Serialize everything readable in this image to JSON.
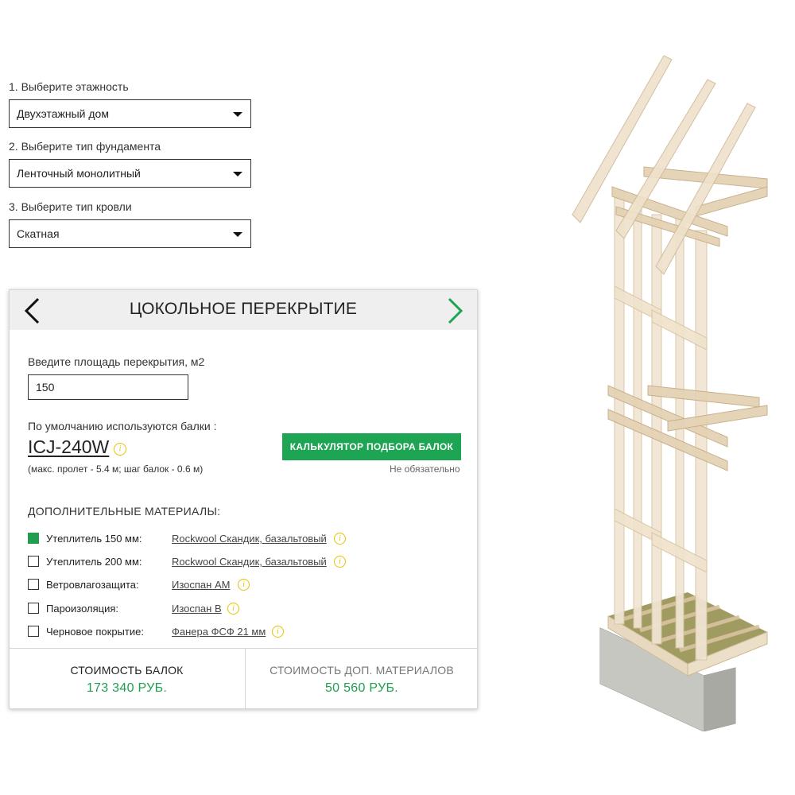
{
  "selectors": [
    {
      "label": "1. Выберите этажность",
      "value": "Двухэтажный дом"
    },
    {
      "label": "2. Выберите тип фундамента",
      "value": "Ленточный монолитный"
    },
    {
      "label": "3. Выберите тип кровли",
      "value": "Скатная"
    }
  ],
  "panel": {
    "title": "ЦОКОЛЬНОЕ ПЕРЕКРЫТИЕ",
    "area_label": "Введите площадь перекрытия, м2",
    "area_value": "150",
    "default_label": "По умолчанию используются балки :",
    "beam_code": "ICJ-240W",
    "beam_note": "(макс. пролет - 5.4 м; шаг балок - 0.6 м)",
    "calc_button": "КАЛЬКУЛЯТОР ПОДБОРА БАЛОК",
    "optional": "Не обязательно",
    "extra_title": "ДОПОЛНИТЕЛЬНЫЕ МАТЕРИАЛЫ:",
    "materials": [
      {
        "name": "Утеплитель 150 мм:",
        "product": "Rockwool Скандик, базальтовый",
        "checked": true
      },
      {
        "name": "Утеплитель 200 мм:",
        "product": "Rockwool Скандик, базальтовый",
        "checked": false
      },
      {
        "name": "Ветровлагозащита:",
        "product": "Изоспан АМ",
        "checked": false
      },
      {
        "name": "Пароизоляция:",
        "product": "Изоспан В",
        "checked": false
      },
      {
        "name": "Черновое покрытие:",
        "product": "Фанера ФСФ 21 мм",
        "checked": false
      }
    ],
    "beam_cost_label": "СТОИМОСТЬ БАЛОК",
    "beam_cost_value": "173 340 РУБ.",
    "extra_cost_label": "СТОИМОСТЬ ДОП. МАТЕРИАЛОВ",
    "extra_cost_value": "50 560 РУБ."
  },
  "icons": {
    "prev": "chevron-left-icon",
    "next": "chevron-right-icon",
    "info": "info-icon",
    "dropdown": "caret-down-icon"
  },
  "colors": {
    "accent_green": "#1ea553",
    "info_yellow": "#e6c200",
    "header_gray": "#efefef"
  }
}
